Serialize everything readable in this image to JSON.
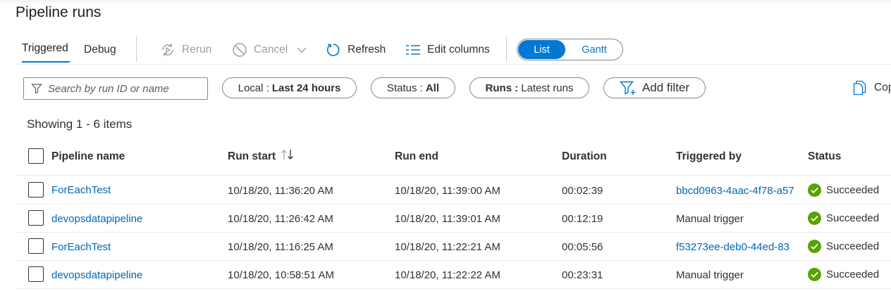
{
  "page": {
    "title": "Pipeline runs"
  },
  "tabs": [
    {
      "label": "Triggered",
      "active": true
    },
    {
      "label": "Debug",
      "active": false
    }
  ],
  "toolbar": {
    "rerun_label": "Rerun",
    "cancel_label": "Cancel",
    "refresh_label": "Refresh",
    "edit_columns_label": "Edit columns"
  },
  "view_toggle": {
    "list_label": "List",
    "gantt_label": "Gantt",
    "selected": "List"
  },
  "search": {
    "placeholder": "Search by run ID or name",
    "value": ""
  },
  "filters": {
    "local_key": "Local :",
    "local_value": "Last 24 hours",
    "status_key": "Status :",
    "status_value": "All",
    "runs_key": "Runs :",
    "runs_value": "Latest runs",
    "add_filter_label": "Add filter",
    "copy_label": "Cop"
  },
  "summary": "Showing 1 - 6 items",
  "table": {
    "columns": [
      "Pipeline name",
      "Run start",
      "Run end",
      "Duration",
      "Triggered by",
      "Status"
    ],
    "rows": [
      {
        "pipeline": "ForEachTest",
        "run_start": "10/18/20, 11:36:20 AM",
        "run_end": "10/18/20, 11:39:00 AM",
        "duration": "00:02:39",
        "triggered_by": "bbcd0963-4aac-4f78-a57",
        "triggered_is_link": true,
        "status": "Succeeded"
      },
      {
        "pipeline": "devopsdatapipeline",
        "run_start": "10/18/20, 11:26:42 AM",
        "run_end": "10/18/20, 11:39:01 AM",
        "duration": "00:12:19",
        "triggered_by": "Manual trigger",
        "triggered_is_link": false,
        "status": "Succeeded"
      },
      {
        "pipeline": "ForEachTest",
        "run_start": "10/18/20, 11:16:25 AM",
        "run_end": "10/18/20, 11:22:21 AM",
        "duration": "00:05:56",
        "triggered_by": "f53273ee-deb0-44ed-83",
        "triggered_is_link": true,
        "status": "Succeeded"
      },
      {
        "pipeline": "devopsdatapipeline",
        "run_start": "10/18/20, 10:58:51 AM",
        "run_end": "10/18/20, 11:22:22 AM",
        "duration": "00:23:31",
        "triggered_by": "Manual trigger",
        "triggered_is_link": false,
        "status": "Succeeded"
      }
    ]
  },
  "colors": {
    "accent": "#0078d4",
    "link": "#0067b8",
    "success": "#57a300"
  }
}
